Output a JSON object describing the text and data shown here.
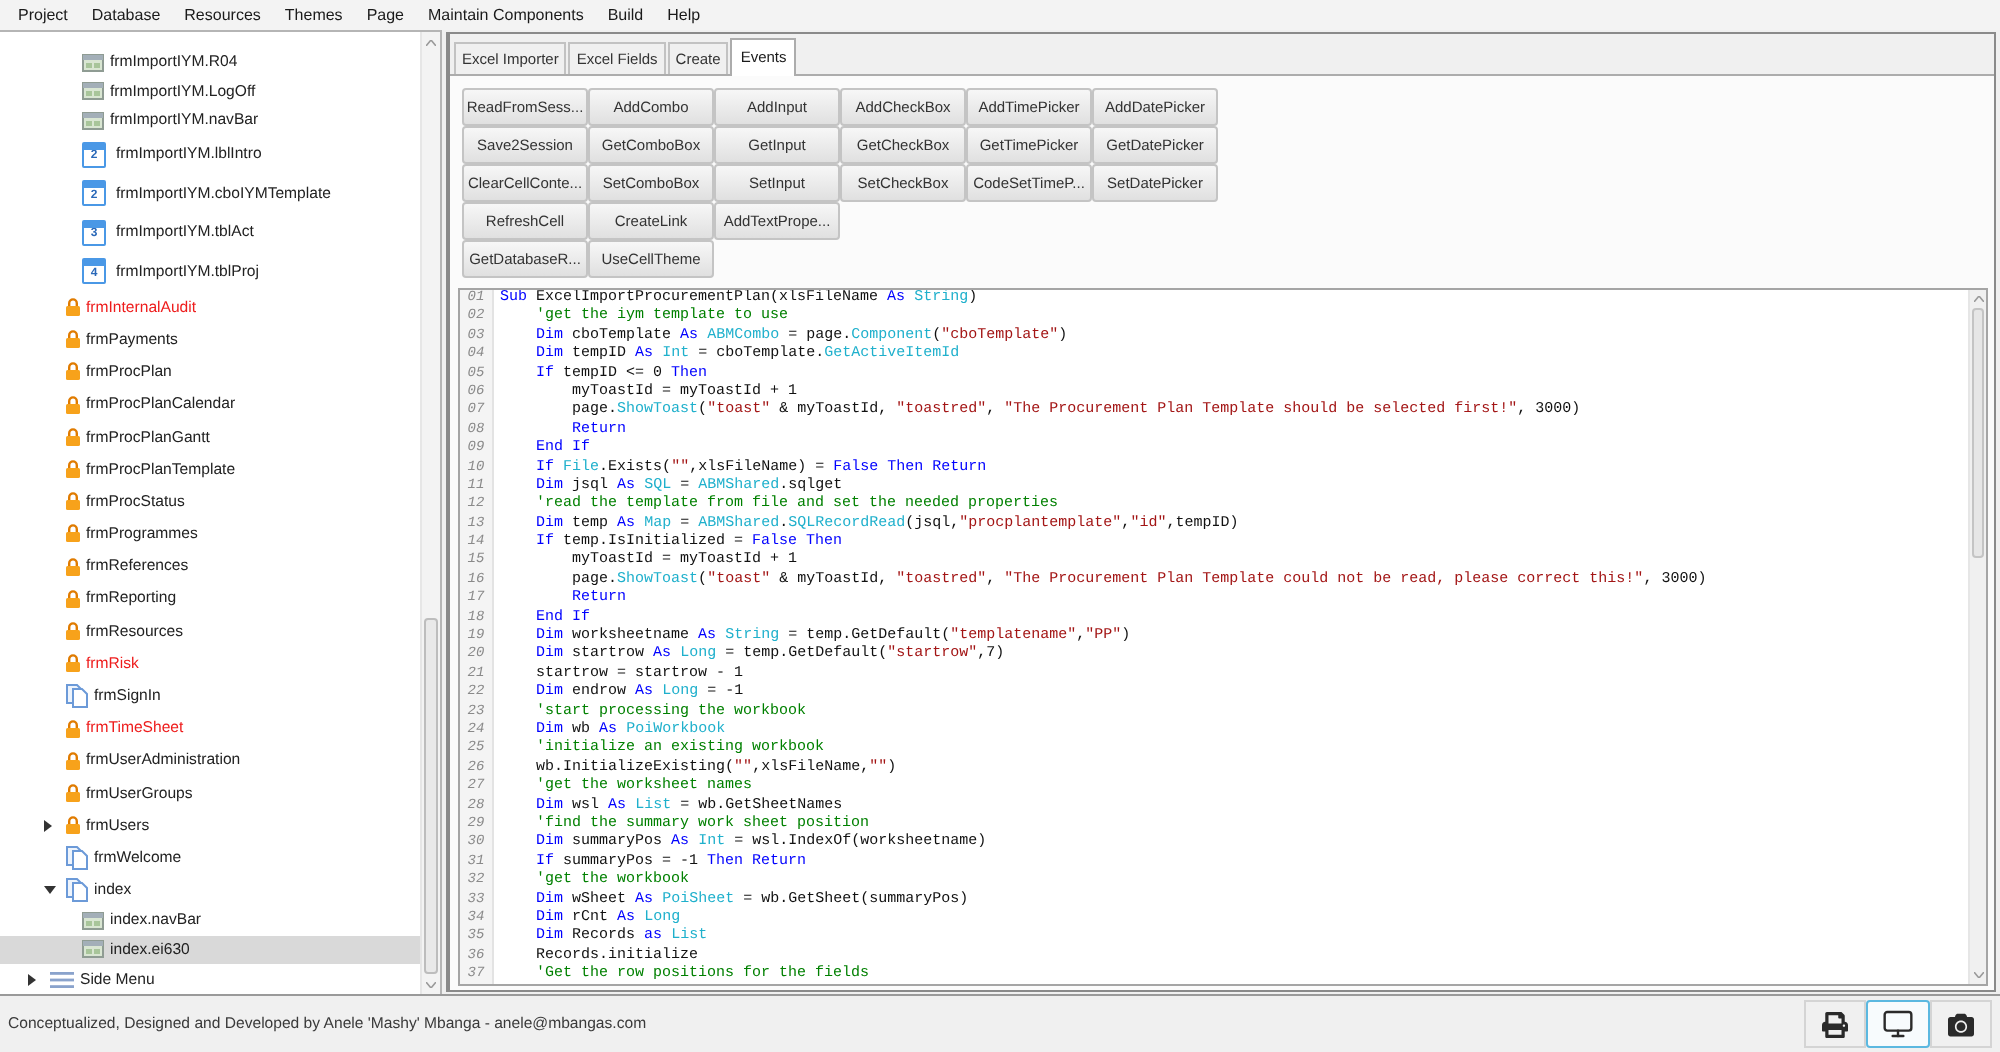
{
  "menu": [
    "Project",
    "Database",
    "Resources",
    "Themes",
    "Page",
    "Maintain Components",
    "Build",
    "Help"
  ],
  "tree": [
    {
      "children": [
        {
          "children": [
            {
              "kind": "component",
              "label": "frmImportIYM.R04",
              "color": "#222222",
              "selected": false
            },
            {
              "kind": "component",
              "label": "frmImportIYM.LogOff",
              "color": "#222222",
              "selected": false
            },
            {
              "kind": "component",
              "label": "frmImportIYM.navBar",
              "color": "#222222",
              "selected": false
            },
            {
              "kind": "ordered",
              "order": "2",
              "label": "frmImportIYM.lblIntro",
              "color": "#222222",
              "selected": false
            },
            {
              "kind": "ordered",
              "order": "2",
              "label": "frmImportIYM.cboIYMTemplate",
              "color": "#222222",
              "selected": false
            },
            {
              "kind": "ordered",
              "order": "3",
              "label": "frmImportIYM.tblAct",
              "color": "#222222",
              "selected": false
            },
            {
              "kind": "ordered",
              "order": "4",
              "label": "frmImportIYM.tblProj",
              "color": "#222222",
              "selected": false
            }
          ]
        },
        {
          "kind": "locked",
          "label": "frmInternalAudit",
          "color": "#ee1c1c",
          "selected": false
        },
        {
          "kind": "locked",
          "label": "frmPayments",
          "color": "#222222",
          "selected": false
        },
        {
          "kind": "locked",
          "label": "frmProcPlan",
          "color": "#222222",
          "selected": false
        },
        {
          "kind": "locked",
          "label": "frmProcPlanCalendar",
          "color": "#222222",
          "selected": false
        },
        {
          "kind": "locked",
          "label": "frmProcPlanGantt",
          "color": "#222222",
          "selected": false
        },
        {
          "kind": "locked",
          "label": "frmProcPlanTemplate",
          "color": "#222222",
          "selected": false
        },
        {
          "kind": "locked",
          "label": "frmProcStatus",
          "color": "#222222",
          "selected": false
        },
        {
          "kind": "locked",
          "label": "frmProgrammes",
          "color": "#222222",
          "selected": false
        },
        {
          "kind": "locked",
          "label": "frmReferences",
          "color": "#222222",
          "selected": false
        },
        {
          "kind": "locked",
          "label": "frmReporting",
          "color": "#222222",
          "selected": false
        },
        {
          "kind": "locked",
          "label": "frmResources",
          "color": "#222222",
          "selected": false
        },
        {
          "kind": "locked",
          "label": "frmRisk",
          "color": "#ee1c1c",
          "selected": false
        },
        {
          "kind": "page",
          "label": "frmSignIn",
          "color": "#222222",
          "selected": false
        },
        {
          "kind": "locked",
          "label": "frmTimeSheet",
          "color": "#ee1c1c",
          "selected": false
        },
        {
          "kind": "locked",
          "label": "frmUserAdministration",
          "color": "#222222",
          "selected": false
        },
        {
          "kind": "locked",
          "label": "frmUserGroups",
          "color": "#222222",
          "selected": false
        },
        {
          "kind": "locked",
          "label": "frmUsers",
          "color": "#222222",
          "selected": false,
          "expanded": false
        },
        {
          "kind": "page",
          "label": "frmWelcome",
          "color": "#222222",
          "selected": false
        },
        {
          "kind": "page",
          "label": "index",
          "color": "#222222",
          "selected": false,
          "expanded": true,
          "children": [
            {
              "kind": "component",
              "label": "index.navBar",
              "color": "#222222",
              "selected": false
            },
            {
              "kind": "component",
              "label": "index.ei630",
              "color": "#222222",
              "selected": true
            }
          ]
        }
      ]
    },
    {
      "kind": "menu",
      "label": "Side Menu",
      "color": "#222222",
      "selected": false,
      "expanded": false
    }
  ],
  "tabs": [
    {
      "label": "Excel Importer",
      "selected": false
    },
    {
      "label": "Excel Fields",
      "selected": false
    },
    {
      "label": "Create",
      "selected": false
    },
    {
      "label": "Events",
      "selected": true
    }
  ],
  "button_rows": [
    [
      "ReadFromSess...",
      "AddCombo",
      "AddInput",
      "AddCheckBox",
      "AddTimePicker",
      "AddDatePicker"
    ],
    [
      "Save2Session",
      "GetComboBox",
      "GetInput",
      "GetCheckBox",
      "GetTimePicker",
      "GetDatePicker"
    ],
    [
      "ClearCellConte...",
      "SetComboBox",
      "SetInput",
      "SetCheckBox",
      "CodeSetTimeP...",
      "SetDatePicker"
    ],
    [
      "RefreshCell",
      "CreateLink",
      "AddTextPrope..."
    ],
    [
      "GetDatabaseR...",
      "UseCellTheme"
    ]
  ],
  "code": {
    "lines": [
      {
        "number": "01",
        "tokens": [
          {
            "kind": "keyword",
            "text": "Sub "
          },
          {
            "kind": "plain",
            "text": "ExcelImportProcurementPlan(xlsFileName "
          },
          {
            "kind": "keyword",
            "text": "As "
          },
          {
            "kind": "type",
            "text": "String"
          },
          {
            "kind": "plain",
            "text": ")"
          }
        ]
      },
      {
        "number": "02",
        "tokens": [
          {
            "kind": "comment",
            "text": "    'get the iym template to use"
          }
        ]
      },
      {
        "number": "03",
        "tokens": [
          {
            "kind": "keyword",
            "text": "    Dim "
          },
          {
            "kind": "plain",
            "text": "cboTemplate "
          },
          {
            "kind": "keyword",
            "text": "As "
          },
          {
            "kind": "type",
            "text": "ABMCombo"
          },
          {
            "kind": "plain",
            "text": " = page."
          },
          {
            "kind": "type",
            "text": "Component"
          },
          {
            "kind": "plain",
            "text": "("
          },
          {
            "kind": "string",
            "text": "\"cboTemplate\""
          },
          {
            "kind": "plain",
            "text": ")"
          }
        ]
      },
      {
        "number": "04",
        "tokens": [
          {
            "kind": "keyword",
            "text": "    Dim "
          },
          {
            "kind": "plain",
            "text": "tempID "
          },
          {
            "kind": "keyword",
            "text": "As "
          },
          {
            "kind": "type",
            "text": "Int"
          },
          {
            "kind": "plain",
            "text": " = cboTemplate."
          },
          {
            "kind": "type",
            "text": "GetActiveItemId"
          }
        ]
      },
      {
        "number": "05",
        "tokens": [
          {
            "kind": "keyword",
            "text": "    If "
          },
          {
            "kind": "plain",
            "text": "tempID <= 0 "
          },
          {
            "kind": "keyword",
            "text": "Then"
          }
        ]
      },
      {
        "number": "06",
        "tokens": [
          {
            "kind": "plain",
            "text": "        myToastId = myToastId + 1"
          }
        ]
      },
      {
        "number": "07",
        "tokens": [
          {
            "kind": "plain",
            "text": "        page."
          },
          {
            "kind": "type",
            "text": "ShowToast"
          },
          {
            "kind": "plain",
            "text": "("
          },
          {
            "kind": "string",
            "text": "\"toast\""
          },
          {
            "kind": "plain",
            "text": " & myToastId, "
          },
          {
            "kind": "string",
            "text": "\"toastred\""
          },
          {
            "kind": "plain",
            "text": ", "
          },
          {
            "kind": "string",
            "text": "\"The Procurement Plan Template should be selected first!\""
          },
          {
            "kind": "plain",
            "text": ", 3000)"
          }
        ]
      },
      {
        "number": "08",
        "tokens": [
          {
            "kind": "keyword",
            "text": "        Return"
          }
        ]
      },
      {
        "number": "09",
        "tokens": [
          {
            "kind": "keyword",
            "text": "    End If"
          }
        ]
      },
      {
        "number": "10",
        "tokens": [
          {
            "kind": "keyword",
            "text": "    If "
          },
          {
            "kind": "type",
            "text": "File"
          },
          {
            "kind": "plain",
            "text": ".Exists("
          },
          {
            "kind": "string",
            "text": "\"\""
          },
          {
            "kind": "plain",
            "text": ",xlsFileName) = "
          },
          {
            "kind": "keyword",
            "text": "False Then Return"
          }
        ]
      },
      {
        "number": "11",
        "tokens": [
          {
            "kind": "keyword",
            "text": "    Dim "
          },
          {
            "kind": "plain",
            "text": "jsql "
          },
          {
            "kind": "keyword",
            "text": "As "
          },
          {
            "kind": "type",
            "text": "SQL"
          },
          {
            "kind": "plain",
            "text": " = "
          },
          {
            "kind": "type",
            "text": "ABMShared"
          },
          {
            "kind": "plain",
            "text": ".sqlget"
          }
        ]
      },
      {
        "number": "12",
        "tokens": [
          {
            "kind": "comment",
            "text": "    'read the template from file and set the needed properties"
          }
        ]
      },
      {
        "number": "13",
        "tokens": [
          {
            "kind": "keyword",
            "text": "    Dim "
          },
          {
            "kind": "plain",
            "text": "temp "
          },
          {
            "kind": "keyword",
            "text": "As "
          },
          {
            "kind": "type",
            "text": "Map"
          },
          {
            "kind": "plain",
            "text": " = "
          },
          {
            "kind": "type",
            "text": "ABMShared"
          },
          {
            "kind": "plain",
            "text": "."
          },
          {
            "kind": "type",
            "text": "SQLRecordRead"
          },
          {
            "kind": "plain",
            "text": "(jsql,"
          },
          {
            "kind": "string",
            "text": "\"procplantemplate\""
          },
          {
            "kind": "plain",
            "text": ","
          },
          {
            "kind": "string",
            "text": "\"id\""
          },
          {
            "kind": "plain",
            "text": ",tempID)"
          }
        ]
      },
      {
        "number": "14",
        "tokens": [
          {
            "kind": "keyword",
            "text": "    If "
          },
          {
            "kind": "plain",
            "text": "temp.IsInitialized = "
          },
          {
            "kind": "keyword",
            "text": "False Then"
          }
        ]
      },
      {
        "number": "15",
        "tokens": [
          {
            "kind": "plain",
            "text": "        myToastId = myToastId + 1"
          }
        ]
      },
      {
        "number": "16",
        "tokens": [
          {
            "kind": "plain",
            "text": "        page."
          },
          {
            "kind": "type",
            "text": "ShowToast"
          },
          {
            "kind": "plain",
            "text": "("
          },
          {
            "kind": "string",
            "text": "\"toast\""
          },
          {
            "kind": "plain",
            "text": " & myToastId, "
          },
          {
            "kind": "string",
            "text": "\"toastred\""
          },
          {
            "kind": "plain",
            "text": ", "
          },
          {
            "kind": "string",
            "text": "\"The Procurement Plan Template could not be read, please correct this!\""
          },
          {
            "kind": "plain",
            "text": ", 3000)"
          }
        ]
      },
      {
        "number": "17",
        "tokens": [
          {
            "kind": "keyword",
            "text": "        Return"
          }
        ]
      },
      {
        "number": "18",
        "tokens": [
          {
            "kind": "keyword",
            "text": "    End If"
          }
        ]
      },
      {
        "number": "19",
        "tokens": [
          {
            "kind": "keyword",
            "text": "    Dim "
          },
          {
            "kind": "plain",
            "text": "worksheetname "
          },
          {
            "kind": "keyword",
            "text": "As "
          },
          {
            "kind": "type",
            "text": "String"
          },
          {
            "kind": "plain",
            "text": " = temp.GetDefault("
          },
          {
            "kind": "string",
            "text": "\"templatename\""
          },
          {
            "kind": "plain",
            "text": ","
          },
          {
            "kind": "string",
            "text": "\"PP\""
          },
          {
            "kind": "plain",
            "text": ")"
          }
        ]
      },
      {
        "number": "20",
        "tokens": [
          {
            "kind": "keyword",
            "text": "    Dim "
          },
          {
            "kind": "plain",
            "text": "startrow "
          },
          {
            "kind": "keyword",
            "text": "As "
          },
          {
            "kind": "type",
            "text": "Long"
          },
          {
            "kind": "plain",
            "text": " = temp.GetDefault("
          },
          {
            "kind": "string",
            "text": "\"startrow\""
          },
          {
            "kind": "plain",
            "text": ",7)"
          }
        ]
      },
      {
        "number": "21",
        "tokens": [
          {
            "kind": "plain",
            "text": "    startrow = startrow - 1"
          }
        ]
      },
      {
        "number": "22",
        "tokens": [
          {
            "kind": "keyword",
            "text": "    Dim "
          },
          {
            "kind": "plain",
            "text": "endrow "
          },
          {
            "kind": "keyword",
            "text": "As "
          },
          {
            "kind": "type",
            "text": "Long"
          },
          {
            "kind": "plain",
            "text": " = -1"
          }
        ]
      },
      {
        "number": "23",
        "tokens": [
          {
            "kind": "comment",
            "text": "    'start processing the workbook"
          }
        ]
      },
      {
        "number": "24",
        "tokens": [
          {
            "kind": "keyword",
            "text": "    Dim "
          },
          {
            "kind": "plain",
            "text": "wb "
          },
          {
            "kind": "keyword",
            "text": "As "
          },
          {
            "kind": "type",
            "text": "PoiWorkbook"
          }
        ]
      },
      {
        "number": "25",
        "tokens": [
          {
            "kind": "comment",
            "text": "    'initialize an existing workbook"
          }
        ]
      },
      {
        "number": "26",
        "tokens": [
          {
            "kind": "plain",
            "text": "    wb.InitializeExisting("
          },
          {
            "kind": "string",
            "text": "\"\""
          },
          {
            "kind": "plain",
            "text": ",xlsFileName,"
          },
          {
            "kind": "string",
            "text": "\"\""
          },
          {
            "kind": "plain",
            "text": ")"
          }
        ]
      },
      {
        "number": "27",
        "tokens": [
          {
            "kind": "comment",
            "text": "    'get the worksheet names"
          }
        ]
      },
      {
        "number": "28",
        "tokens": [
          {
            "kind": "keyword",
            "text": "    Dim "
          },
          {
            "kind": "plain",
            "text": "wsl "
          },
          {
            "kind": "keyword",
            "text": "As "
          },
          {
            "kind": "type",
            "text": "List"
          },
          {
            "kind": "plain",
            "text": " = wb.GetSheetNames"
          }
        ]
      },
      {
        "number": "29",
        "tokens": [
          {
            "kind": "comment",
            "text": "    'find the summary work sheet position"
          }
        ]
      },
      {
        "number": "30",
        "tokens": [
          {
            "kind": "keyword",
            "text": "    Dim "
          },
          {
            "kind": "plain",
            "text": "summaryPos "
          },
          {
            "kind": "keyword",
            "text": "As "
          },
          {
            "kind": "type",
            "text": "Int"
          },
          {
            "kind": "plain",
            "text": " = wsl.IndexOf(worksheetname)"
          }
        ]
      },
      {
        "number": "31",
        "tokens": [
          {
            "kind": "keyword",
            "text": "    If "
          },
          {
            "kind": "plain",
            "text": "summaryPos = -1 "
          },
          {
            "kind": "keyword",
            "text": "Then Return"
          }
        ]
      },
      {
        "number": "32",
        "tokens": [
          {
            "kind": "comment",
            "text": "    'get the workbook"
          }
        ]
      },
      {
        "number": "33",
        "tokens": [
          {
            "kind": "keyword",
            "text": "    Dim "
          },
          {
            "kind": "plain",
            "text": "wSheet "
          },
          {
            "kind": "keyword",
            "text": "As "
          },
          {
            "kind": "type",
            "text": "PoiSheet"
          },
          {
            "kind": "plain",
            "text": " = wb.GetSheet(summaryPos)"
          }
        ]
      },
      {
        "number": "34",
        "tokens": [
          {
            "kind": "keyword",
            "text": "    Dim "
          },
          {
            "kind": "plain",
            "text": "rCnt "
          },
          {
            "kind": "keyword",
            "text": "As "
          },
          {
            "kind": "type",
            "text": "Long"
          }
        ]
      },
      {
        "number": "35",
        "tokens": [
          {
            "kind": "keyword",
            "text": "    Dim "
          },
          {
            "kind": "plain",
            "text": "Records "
          },
          {
            "kind": "keyword",
            "text": "as "
          },
          {
            "kind": "type",
            "text": "List"
          }
        ]
      },
      {
        "number": "36",
        "tokens": [
          {
            "kind": "plain",
            "text": "    Records.initialize"
          }
        ]
      },
      {
        "number": "37",
        "tokens": [
          {
            "kind": "comment",
            "text": "    'Get the row positions for the fields"
          }
        ]
      }
    ]
  },
  "status_bar": {
    "credit": "Conceptualized, Designed and Developed by Anele 'Mashy' Mbanga - anele@mbangas.com",
    "tools": [
      {
        "kind": "print",
        "selected": false
      },
      {
        "kind": "display",
        "selected": true
      },
      {
        "kind": "camera",
        "selected": false
      }
    ]
  }
}
